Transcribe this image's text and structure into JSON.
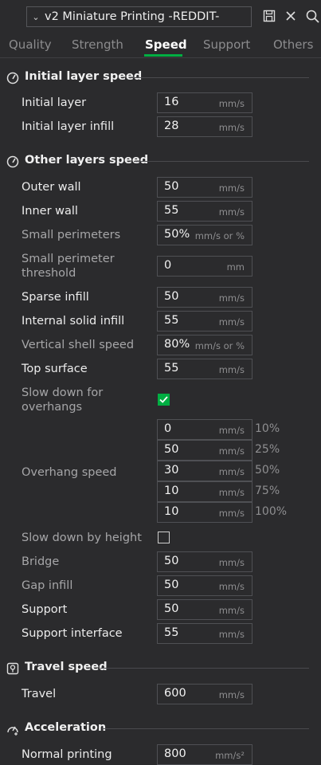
{
  "header": {
    "profile_name": "v2 Miniature Printing -REDDIT-"
  },
  "tabs": [
    {
      "label": "Quality"
    },
    {
      "label": "Strength"
    },
    {
      "label": "Speed"
    },
    {
      "label": "Support"
    },
    {
      "label": "Others"
    }
  ],
  "sections": {
    "initial": {
      "title": "Initial layer speed",
      "rows": [
        {
          "label": "Initial layer",
          "value": "16",
          "unit": "mm/s"
        },
        {
          "label": "Initial layer infill",
          "value": "28",
          "unit": "mm/s"
        }
      ]
    },
    "other": {
      "title": "Other layers speed",
      "rows": [
        {
          "label": "Outer wall",
          "value": "50",
          "unit": "mm/s"
        },
        {
          "label": "Inner wall",
          "value": "55",
          "unit": "mm/s"
        },
        {
          "label": "Small perimeters",
          "value": "50%",
          "unit": "mm/s or %"
        },
        {
          "label": "Small perimeter threshold",
          "value": "0",
          "unit": "mm"
        },
        {
          "label": "Sparse infill",
          "value": "50",
          "unit": "mm/s"
        },
        {
          "label": "Internal solid infill",
          "value": "55",
          "unit": "mm/s"
        },
        {
          "label": "Vertical shell speed",
          "value": "80%",
          "unit": "mm/s or %"
        },
        {
          "label": "Top surface",
          "value": "55",
          "unit": "mm/s"
        }
      ],
      "slow_overhangs": {
        "label": "Slow down for overhangs",
        "checked": true
      },
      "overhang": {
        "label": "Overhang speed",
        "rows": [
          {
            "value": "0",
            "unit": "mm/s",
            "pct": "10%"
          },
          {
            "value": "50",
            "unit": "mm/s",
            "pct": "25%"
          },
          {
            "value": "30",
            "unit": "mm/s",
            "pct": "50%"
          },
          {
            "value": "10",
            "unit": "mm/s",
            "pct": "75%"
          },
          {
            "value": "10",
            "unit": "mm/s",
            "pct": "100%"
          }
        ]
      },
      "slow_height": {
        "label": "Slow down by height",
        "checked": false
      },
      "rows2": [
        {
          "label": "Bridge",
          "value": "50",
          "unit": "mm/s"
        },
        {
          "label": "Gap infill",
          "value": "50",
          "unit": "mm/s"
        },
        {
          "label": "Support",
          "value": "50",
          "unit": "mm/s"
        },
        {
          "label": "Support interface",
          "value": "55",
          "unit": "mm/s"
        }
      ]
    },
    "travel": {
      "title": "Travel speed",
      "rows": [
        {
          "label": "Travel",
          "value": "600",
          "unit": "mm/s"
        }
      ]
    },
    "accel": {
      "title": "Acceleration",
      "rows": [
        {
          "label": "Normal printing",
          "value": "800",
          "unit": "mm/s²"
        }
      ]
    }
  },
  "colors": {
    "accent": "#00ae42",
    "background": "#2b2b2d"
  },
  "icons": [
    "chevron-down-icon",
    "save-icon",
    "close-icon",
    "search-icon",
    "speedometer-icon",
    "travel-icon",
    "acceleration-icon"
  ]
}
